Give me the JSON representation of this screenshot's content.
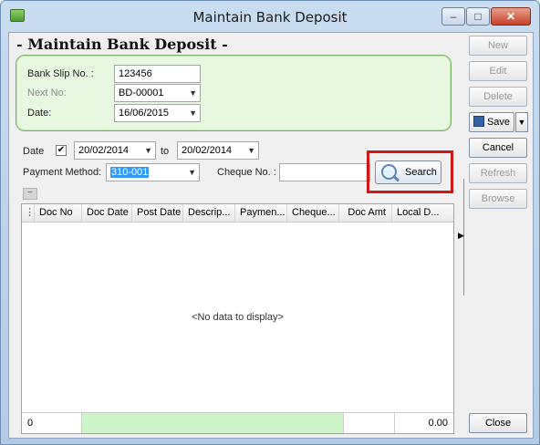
{
  "window": {
    "title": "Maintain Bank Deposit",
    "min_label": "–",
    "max_label": "□",
    "close_label": "✕"
  },
  "heading": "- Maintain Bank Deposit -",
  "header": {
    "bank_slip_label": "Bank Slip No. :",
    "bank_slip_value": "123456",
    "next_no_label": "Next No:",
    "next_no_value": "BD-00001",
    "date_label": "Date:",
    "date_value": "16/06/2015"
  },
  "filter": {
    "date_label": "Date",
    "date_checked": "✔",
    "date_from": "20/02/2014",
    "to_label": "to",
    "date_to": "20/02/2014",
    "payment_method_label": "Payment Method:",
    "payment_method_value": "310-001",
    "cheque_label": "Cheque No. :",
    "cheque_value": "",
    "search_label": "Search"
  },
  "grid": {
    "columns": [
      "Doc No",
      "Doc Date",
      "Post Date",
      "Descrip...",
      "Paymen...",
      "Cheque...",
      "Doc Amt",
      "Local D..."
    ],
    "empty_text": "<No data to display>",
    "footer_count": "0",
    "footer_total": "0.00"
  },
  "actions": {
    "new": "New",
    "edit": "Edit",
    "delete": "Delete",
    "save": "Save",
    "cancel": "Cancel",
    "refresh": "Refresh",
    "browse": "Browse",
    "close": "Close"
  },
  "colors": {
    "highlight": "#d01616",
    "group_bg": "#e7f7e0",
    "footer_green": "#cdf5c9"
  }
}
